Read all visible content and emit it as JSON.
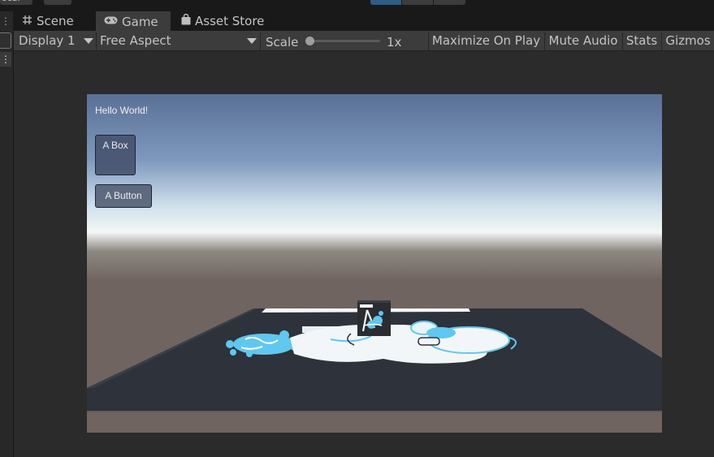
{
  "tabs": [
    {
      "label": "Scene",
      "icon": "grid-icon",
      "active": false
    },
    {
      "label": "Game",
      "icon": "gamepad-icon",
      "active": true
    },
    {
      "label": "Asset Store",
      "icon": "shopping-bag-icon",
      "active": false
    }
  ],
  "toolbar": {
    "display": "Display 1",
    "aspect": "Free Aspect",
    "scale_label": "Scale",
    "scale_value": "1x",
    "scale_level": 0.0,
    "maximize": "Maximize On Play",
    "mute": "Mute Audio",
    "stats": "Stats",
    "gizmos": "Gizmos"
  },
  "top": {
    "cut_text": "ocal",
    "play_active_color": "#2d5d87"
  },
  "game": {
    "hello": "Hello World!",
    "box_label": "A Box",
    "button_label": "A Button",
    "sky_top": "#5a7096",
    "sky_horizon": "#eef4f8",
    "ground": "#6f6460",
    "plane": "#2e323a",
    "accent": "#5ec8f0"
  }
}
